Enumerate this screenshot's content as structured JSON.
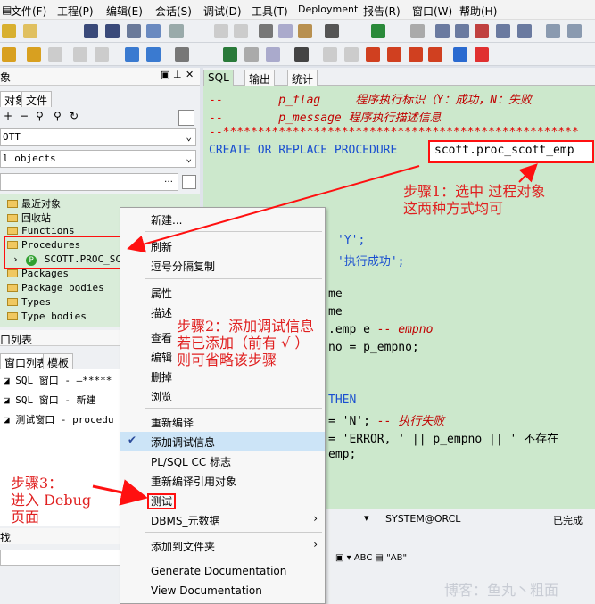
{
  "menu": [
    "文件(F)",
    "工程(P)",
    "编辑(E)",
    "会话(S)",
    "调试(D)",
    "工具(T)",
    "Deployment",
    "报告(R)",
    "窗口(W)",
    "帮助(H)"
  ],
  "left_panel": {
    "title": "象",
    "tabs": [
      "对象",
      "文件"
    ],
    "user_combo": "OTT",
    "filter_combo": "l objects",
    "tree": [
      "最近对象",
      "回收站",
      "Functions",
      "Procedures",
      "SCOTT.PROC_SCO",
      "Packages",
      "Package bodies",
      "Types",
      "Type bodies"
    ],
    "winlist_title": "口列表",
    "winlist_tabs": [
      "窗口列表",
      "模板"
    ],
    "windows": [
      "SQL 窗口 - —*****",
      "SQL 窗口 - 新建",
      "测试窗口 - procedu"
    ],
    "find_label": "找"
  },
  "editor": {
    "tabs": [
      "SQL",
      "输出",
      "统计"
    ],
    "comment1_prefix": "--",
    "comment1_param": "p_flag",
    "comment1_text": "程序执行标识（Y：成功，N：失败",
    "comment2_prefix": "--",
    "comment2_param": "p_message",
    "comment2_text": "程序执行描述信息",
    "stars": "--***************************************************",
    "create_stmt": "CREATE OR REPLACE PROCEDURE",
    "proc_name": "scott.proc_scott_emp",
    "lines": [
      {
        "code": "'Y';",
        "cls": "blue"
      },
      {
        "code": "'执行成功';",
        "cls": "blue"
      },
      {
        "code": "me",
        "cls": ""
      },
      {
        "code": "me",
        "cls": ""
      },
      {
        "code": ".emp e",
        "cls": "",
        "comment": "-- empno"
      },
      {
        "code": "no = p_empno;",
        "cls": ""
      },
      {
        "code": "THEN",
        "cls": "blue"
      },
      {
        "code": "= 'N';",
        "cls": "",
        "comment": "-- 执行失败"
      },
      {
        "code": "= 'ERROR, ' || p_empno || ' 不存在",
        "cls": ""
      },
      {
        "code": "emp;",
        "cls": ""
      }
    ]
  },
  "status": {
    "connection": "SYSTEM@ORCL",
    "saved": "已完成"
  },
  "context_menu": {
    "items": [
      "新建...",
      "刷新",
      "逗号分隔复制",
      "属性",
      "描述",
      "查看",
      "编辑",
      "删掉",
      "浏览",
      "重新编译",
      "添加调试信息",
      "PL/SQL CC 标志",
      "重新编译引用对象",
      "测试",
      "DBMS_元数据",
      "添加到文件夹",
      "Generate Documentation",
      "View Documentation"
    ]
  },
  "annotations": {
    "step1_line1": "步骤1：选中 过程对象",
    "step1_line2": "这两种方式均可",
    "step2_line1": "步骤2：添加调试信息",
    "step2_line2": "若已添加（前有 √ ）",
    "step2_line3": "则可省略该步骤",
    "step3_line1": "步骤3：",
    "step3_line2": "进入 Debug",
    "step3_line3": "页面"
  },
  "watermark": "博客：鱼丸丶粗面",
  "colors": {
    "editor_bg": "#cce8cc",
    "annotation": "#e02020",
    "keyword": "#1a4fd0",
    "comment": "#e00000",
    "menu_highlight": "#cce4f7"
  }
}
